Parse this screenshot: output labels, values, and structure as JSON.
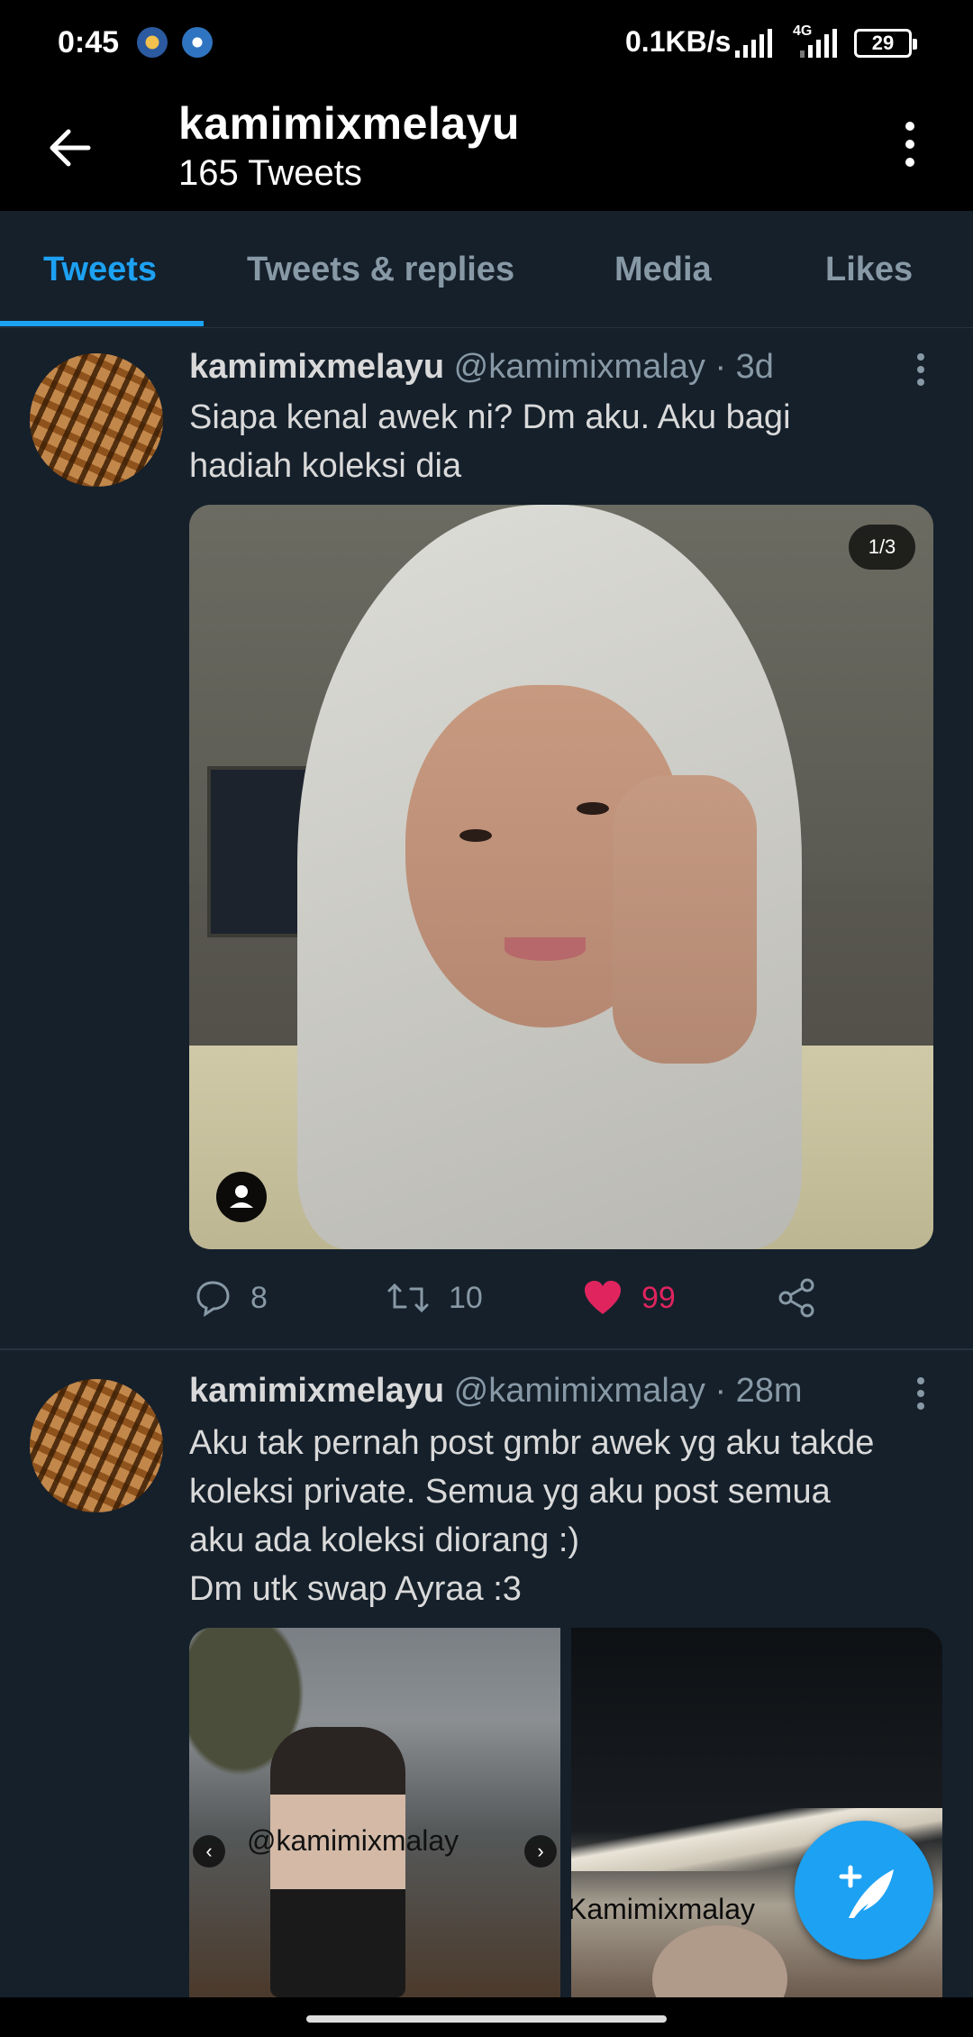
{
  "status_bar": {
    "time": "0:45",
    "net_speed": "0.1KB/s",
    "network_type": "4G",
    "battery": "29"
  },
  "header": {
    "title": "kamimixmelayu",
    "subtitle": "165 Tweets"
  },
  "tabs": [
    {
      "label": "Tweets",
      "active": true
    },
    {
      "label": "Tweets & replies",
      "active": false
    },
    {
      "label": "Media",
      "active": false
    },
    {
      "label": "Likes",
      "active": false
    }
  ],
  "tweets": [
    {
      "name": "kamimixmelayu",
      "handle": "@kamimixmalay · 3d",
      "text_lines": [
        "Siapa kenal awek ni? Dm aku. Aku bagi",
        "hadiah koleksi dia"
      ],
      "media_counter": "1/3",
      "replies": "8",
      "retweets": "10",
      "likes": "99"
    },
    {
      "name": "kamimixmelayu",
      "handle": "@kamimixmalay · 28m",
      "text_lines": [
        "Aku tak pernah post gmbr awek yg aku takde",
        "koleksi private. Semua yg aku post semua",
        "aku ada koleksi diorang :)",
        "Dm utk swap Ayraa :3"
      ],
      "watermark_left": "@kamimixmalay",
      "watermark_right": "Kamimixmalay"
    }
  ],
  "colors": {
    "background": "#15202b",
    "accent": "#1da1f2",
    "like": "#e0245e",
    "secondary_text": "#8899a6"
  }
}
